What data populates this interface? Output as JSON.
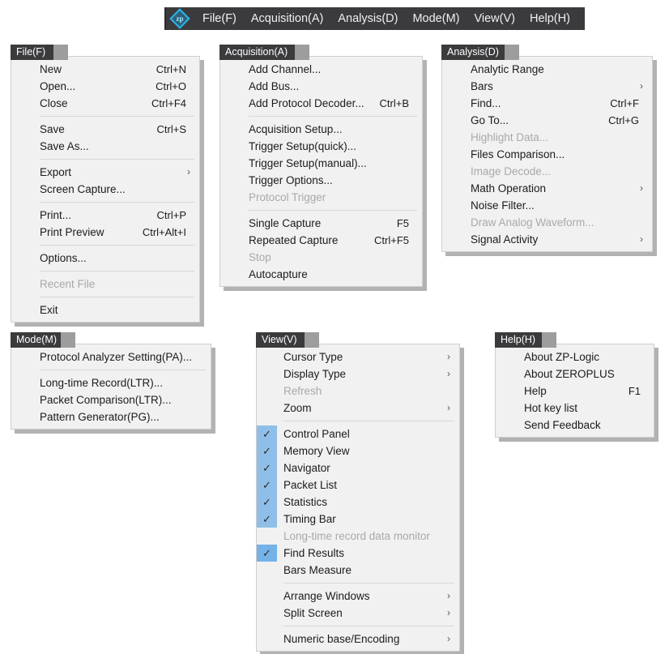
{
  "menubar": {
    "logo_icon": "zeroplus-diamond-logo-icon",
    "logo_glyph": "zp",
    "items": [
      {
        "label": "File(F)"
      },
      {
        "label": "Acquisition(A)"
      },
      {
        "label": "Analysis(D)"
      },
      {
        "label": "Mode(M)"
      },
      {
        "label": "View(V)"
      },
      {
        "label": "Help(H)"
      }
    ]
  },
  "colors": {
    "menubar_bg": "#3b3b3e",
    "menu_panel_bg": "#f1f1f1",
    "menu_text": "#1b1b1b",
    "menu_disabled_text": "#a9a9a9",
    "check_gutter": "#8fbfe8",
    "check_gutter_strong": "#74b2e8",
    "logo_accent": "#29b6e8",
    "separator": "#d7d7d7"
  },
  "menus": {
    "file": {
      "title": "File(F)",
      "items": [
        {
          "label": "New",
          "shortcut": "Ctrl+N",
          "disabled": false,
          "submenu": false
        },
        {
          "label": "Open...",
          "shortcut": "Ctrl+O",
          "disabled": false,
          "submenu": false
        },
        {
          "label": "Close",
          "shortcut": "Ctrl+F4",
          "disabled": false,
          "submenu": false
        },
        {
          "separator": true
        },
        {
          "label": "Save",
          "shortcut": "Ctrl+S",
          "disabled": false,
          "submenu": false
        },
        {
          "label": "Save As...",
          "shortcut": "",
          "disabled": false,
          "submenu": false
        },
        {
          "separator": true
        },
        {
          "label": "Export",
          "shortcut": "",
          "disabled": false,
          "submenu": true
        },
        {
          "label": "Screen Capture...",
          "shortcut": "",
          "disabled": false,
          "submenu": false
        },
        {
          "separator": true
        },
        {
          "label": "Print...",
          "shortcut": "Ctrl+P",
          "disabled": false,
          "submenu": false
        },
        {
          "label": "Print Preview",
          "shortcut": "Ctrl+Alt+I",
          "disabled": false,
          "submenu": false
        },
        {
          "separator": true
        },
        {
          "label": "Options...",
          "shortcut": "",
          "disabled": false,
          "submenu": false
        },
        {
          "separator": true
        },
        {
          "label": "Recent File",
          "shortcut": "",
          "disabled": true,
          "submenu": false
        },
        {
          "separator": true
        },
        {
          "label": "Exit",
          "shortcut": "",
          "disabled": false,
          "submenu": false
        }
      ]
    },
    "acquisition": {
      "title": "Acquisition(A)",
      "items": [
        {
          "label": "Add Channel...",
          "shortcut": "",
          "disabled": false,
          "submenu": false
        },
        {
          "label": "Add Bus...",
          "shortcut": "",
          "disabled": false,
          "submenu": false
        },
        {
          "label": "Add Protocol Decoder...",
          "shortcut": "Ctrl+B",
          "disabled": false,
          "submenu": false
        },
        {
          "separator": true
        },
        {
          "label": "Acquisition Setup...",
          "shortcut": "",
          "disabled": false,
          "submenu": false
        },
        {
          "label": "Trigger Setup(quick)...",
          "shortcut": "",
          "disabled": false,
          "submenu": false
        },
        {
          "label": "Trigger Setup(manual)...",
          "shortcut": "",
          "disabled": false,
          "submenu": false
        },
        {
          "label": "Trigger Options...",
          "shortcut": "",
          "disabled": false,
          "submenu": false
        },
        {
          "label": "Protocol Trigger",
          "shortcut": "",
          "disabled": true,
          "submenu": false
        },
        {
          "separator": true
        },
        {
          "label": "Single Capture",
          "shortcut": "F5",
          "disabled": false,
          "submenu": false
        },
        {
          "label": "Repeated Capture",
          "shortcut": "Ctrl+F5",
          "disabled": false,
          "submenu": false
        },
        {
          "label": "Stop",
          "shortcut": "",
          "disabled": true,
          "submenu": false
        },
        {
          "label": "Autocapture",
          "shortcut": "",
          "disabled": false,
          "submenu": false
        }
      ]
    },
    "analysis": {
      "title": "Analysis(D)",
      "items": [
        {
          "label": "Analytic Range",
          "shortcut": "",
          "disabled": false,
          "submenu": false
        },
        {
          "label": "Bars",
          "shortcut": "",
          "disabled": false,
          "submenu": true
        },
        {
          "label": "Find...",
          "shortcut": "Ctrl+F",
          "disabled": false,
          "submenu": false
        },
        {
          "label": "Go To...",
          "shortcut": "Ctrl+G",
          "disabled": false,
          "submenu": false
        },
        {
          "label": "Highlight Data...",
          "shortcut": "",
          "disabled": true,
          "submenu": false
        },
        {
          "label": "Files Comparison...",
          "shortcut": "",
          "disabled": false,
          "submenu": false
        },
        {
          "label": "Image Decode...",
          "shortcut": "",
          "disabled": true,
          "submenu": false
        },
        {
          "label": "Math Operation",
          "shortcut": "",
          "disabled": false,
          "submenu": true
        },
        {
          "label": "Noise Filter...",
          "shortcut": "",
          "disabled": false,
          "submenu": false
        },
        {
          "label": "Draw Analog Waveform...",
          "shortcut": "",
          "disabled": true,
          "submenu": false
        },
        {
          "label": "Signal Activity",
          "shortcut": "",
          "disabled": false,
          "submenu": true
        }
      ]
    },
    "mode": {
      "title": "Mode(M)",
      "items": [
        {
          "label": "Protocol Analyzer Setting(PA)...",
          "shortcut": "",
          "disabled": false,
          "submenu": false
        },
        {
          "separator": true
        },
        {
          "label": "Long-time Record(LTR)...",
          "shortcut": "",
          "disabled": false,
          "submenu": false
        },
        {
          "label": "Packet Comparison(LTR)...",
          "shortcut": "",
          "disabled": false,
          "submenu": false
        },
        {
          "label": "Pattern Generator(PG)...",
          "shortcut": "",
          "disabled": false,
          "submenu": false
        }
      ]
    },
    "view": {
      "title": "View(V)",
      "items": [
        {
          "label": "Cursor Type",
          "shortcut": "",
          "disabled": false,
          "submenu": true,
          "checked": false
        },
        {
          "label": "Display Type",
          "shortcut": "",
          "disabled": false,
          "submenu": true,
          "checked": false
        },
        {
          "label": "Refresh",
          "shortcut": "",
          "disabled": true,
          "submenu": false,
          "checked": false
        },
        {
          "label": "Zoom",
          "shortcut": "",
          "disabled": false,
          "submenu": true,
          "checked": false
        },
        {
          "separator": true
        },
        {
          "label": "Control Panel",
          "shortcut": "",
          "disabled": false,
          "submenu": false,
          "checked": true
        },
        {
          "label": "Memory View",
          "shortcut": "",
          "disabled": false,
          "submenu": false,
          "checked": true
        },
        {
          "label": "Navigator",
          "shortcut": "",
          "disabled": false,
          "submenu": false,
          "checked": true
        },
        {
          "label": "Packet List",
          "shortcut": "",
          "disabled": false,
          "submenu": false,
          "checked": true
        },
        {
          "label": "Statistics",
          "shortcut": "",
          "disabled": false,
          "submenu": false,
          "checked": true
        },
        {
          "label": "Timing Bar",
          "shortcut": "",
          "disabled": false,
          "submenu": false,
          "checked": true
        },
        {
          "label": "Long-time record data monitor",
          "shortcut": "",
          "disabled": true,
          "submenu": false,
          "checked": false
        },
        {
          "label": "Find Results",
          "shortcut": "",
          "disabled": false,
          "submenu": false,
          "checked": true,
          "highlight": true
        },
        {
          "label": "Bars Measure",
          "shortcut": "",
          "disabled": false,
          "submenu": false,
          "checked": false
        },
        {
          "separator": true
        },
        {
          "label": "Arrange Windows",
          "shortcut": "",
          "disabled": false,
          "submenu": true,
          "checked": false
        },
        {
          "label": "Split Screen",
          "shortcut": "",
          "disabled": false,
          "submenu": true,
          "checked": false
        },
        {
          "separator": true
        },
        {
          "label": "Numeric base/Encoding",
          "shortcut": "",
          "disabled": false,
          "submenu": true,
          "checked": false
        }
      ]
    },
    "help": {
      "title": "Help(H)",
      "items": [
        {
          "label": "About ZP-Logic",
          "shortcut": "",
          "disabled": false,
          "submenu": false
        },
        {
          "label": "About ZEROPLUS",
          "shortcut": "",
          "disabled": false,
          "submenu": false
        },
        {
          "label": "Help",
          "shortcut": "F1",
          "disabled": false,
          "submenu": false
        },
        {
          "label": "Hot key list",
          "shortcut": "",
          "disabled": false,
          "submenu": false
        },
        {
          "label": "Send Feedback",
          "shortcut": "",
          "disabled": false,
          "submenu": false
        }
      ]
    }
  }
}
